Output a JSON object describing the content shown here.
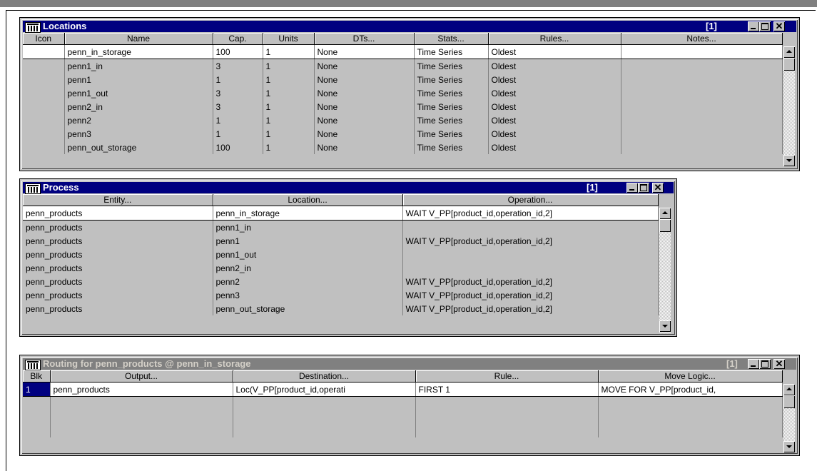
{
  "locations": {
    "title": "Locations",
    "count": "[1]",
    "columns": [
      "Icon",
      "Name",
      "Cap.",
      "Units",
      "DTs...",
      "Stats...",
      "Rules...",
      "Notes..."
    ],
    "rows": [
      {
        "icon": "",
        "name": "penn_in_storage",
        "cap": "100",
        "units": "1",
        "dts": "None",
        "stats": "Time Series",
        "rules": "Oldest",
        "notes": ""
      },
      {
        "icon": "",
        "name": "penn1_in",
        "cap": "3",
        "units": "1",
        "dts": "None",
        "stats": "Time Series",
        "rules": "Oldest",
        "notes": ""
      },
      {
        "icon": "",
        "name": "penn1",
        "cap": "1",
        "units": "1",
        "dts": "None",
        "stats": "Time Series",
        "rules": "Oldest",
        "notes": ""
      },
      {
        "icon": "",
        "name": "penn1_out",
        "cap": "3",
        "units": "1",
        "dts": "None",
        "stats": "Time Series",
        "rules": "Oldest",
        "notes": ""
      },
      {
        "icon": "",
        "name": "penn2_in",
        "cap": "3",
        "units": "1",
        "dts": "None",
        "stats": "Time Series",
        "rules": "Oldest",
        "notes": ""
      },
      {
        "icon": "",
        "name": "penn2",
        "cap": "1",
        "units": "1",
        "dts": "None",
        "stats": "Time Series",
        "rules": "Oldest",
        "notes": ""
      },
      {
        "icon": "",
        "name": "penn3",
        "cap": "1",
        "units": "1",
        "dts": "None",
        "stats": "Time Series",
        "rules": "Oldest",
        "notes": ""
      },
      {
        "icon": "",
        "name": "penn_out_storage",
        "cap": "100",
        "units": "1",
        "dts": "None",
        "stats": "Time Series",
        "rules": "Oldest",
        "notes": ""
      }
    ]
  },
  "process": {
    "title": "Process",
    "count": "[1]",
    "columns": [
      "Entity...",
      "Location...",
      "Operation..."
    ],
    "rows": [
      {
        "entity": "penn_products",
        "location": "penn_in_storage",
        "operation": "WAIT V_PP[product_id,operation_id,2]"
      },
      {
        "entity": "penn_products",
        "location": "penn1_in",
        "operation": ""
      },
      {
        "entity": "penn_products",
        "location": "penn1",
        "operation": "WAIT V_PP[product_id,operation_id,2]"
      },
      {
        "entity": "penn_products",
        "location": "penn1_out",
        "operation": ""
      },
      {
        "entity": "penn_products",
        "location": "penn2_in",
        "operation": ""
      },
      {
        "entity": "penn_products",
        "location": "penn2",
        "operation": "WAIT V_PP[product_id,operation_id,2]"
      },
      {
        "entity": "penn_products",
        "location": "penn3",
        "operation": "WAIT V_PP[product_id,operation_id,2]"
      },
      {
        "entity": "penn_products",
        "location": "penn_out_storage",
        "operation": "WAIT V_PP[product_id,operation_id,2]"
      }
    ]
  },
  "routing": {
    "title": "Routing for penn_products @ penn_in_storage",
    "count": "[1]",
    "columns": [
      "Blk",
      "Output...",
      "Destination...",
      "Rule...",
      "Move Logic..."
    ],
    "rows": [
      {
        "blk": "1",
        "output": "penn_products",
        "destination": "Loc(V_PP[product_id,operati",
        "rule": "FIRST 1",
        "move_logic": "MOVE FOR V_PP[product_id,"
      }
    ]
  },
  "icons": {
    "window": "grid-icon",
    "minimize": "minimize-icon",
    "maximize": "maximize-icon",
    "close": "close-icon"
  },
  "colors": {
    "active_title": "#000080",
    "inactive_title": "#808080",
    "face": "#c0c0c0"
  }
}
